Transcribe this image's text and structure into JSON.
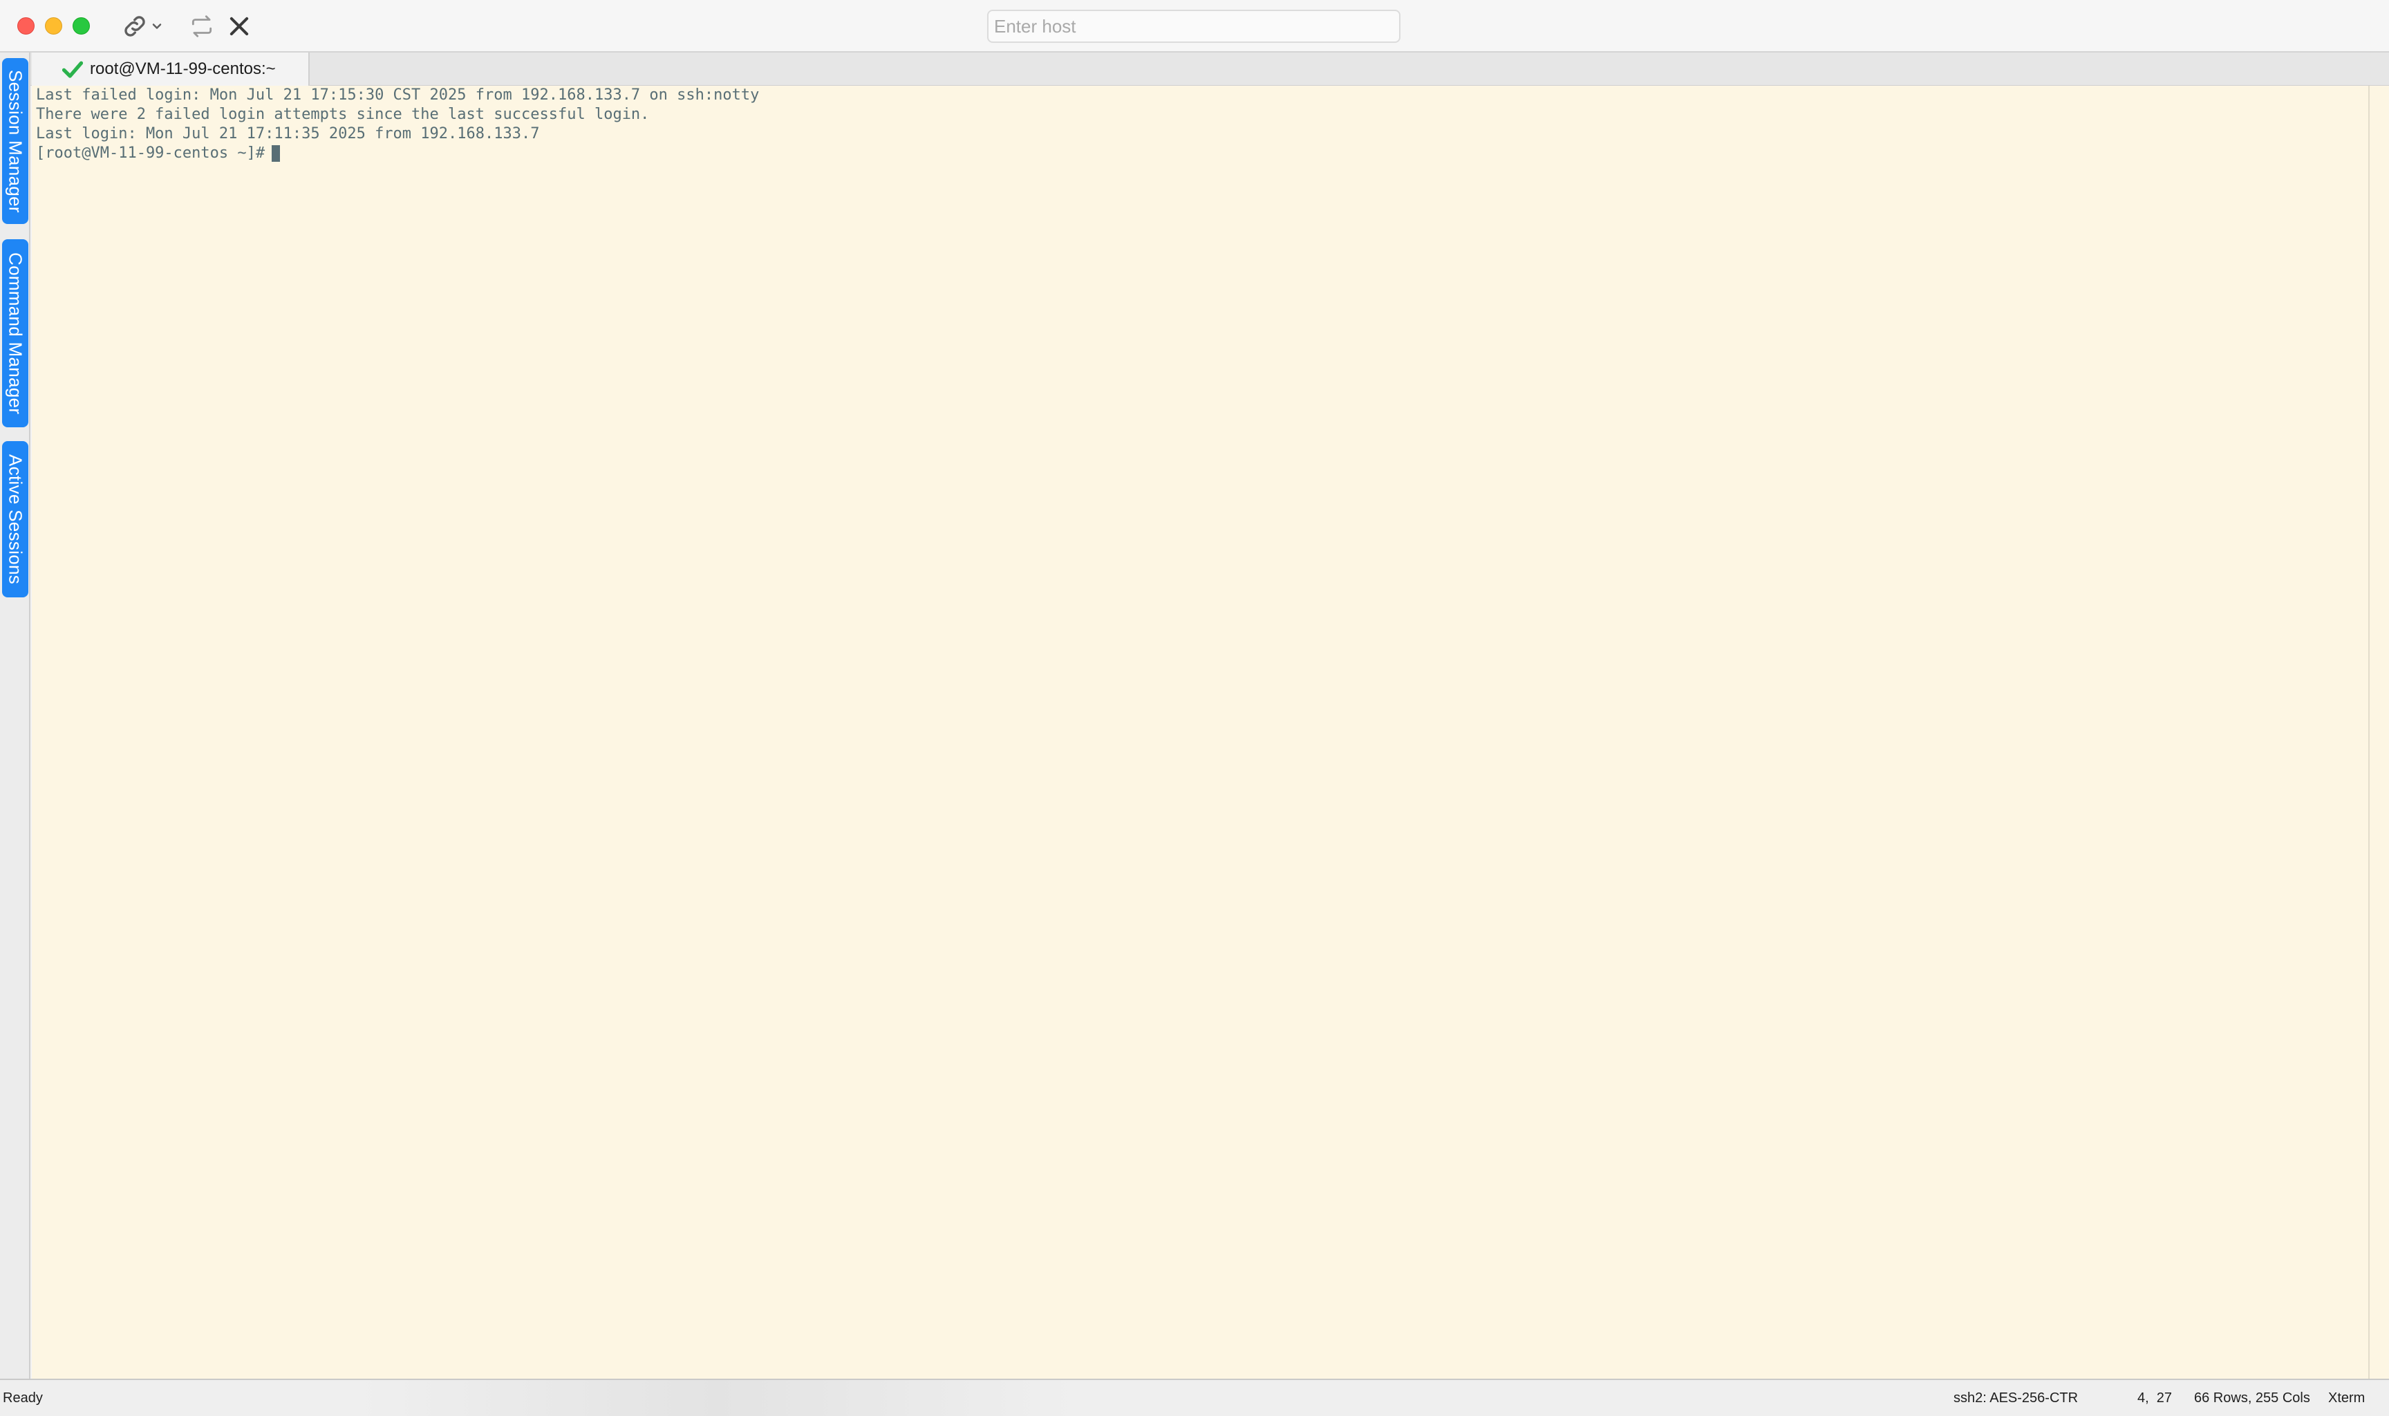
{
  "titlebar": {
    "host_placeholder": "Enter host",
    "host_value": "",
    "icons": {
      "link": "link-icon",
      "dropdown": "chevron-down-icon",
      "reconnect": "reconnect-icon",
      "disconnect": "close-icon"
    }
  },
  "sidebar": {
    "tabs": [
      {
        "label": "Session Manager"
      },
      {
        "label": "Command Manager"
      },
      {
        "label": "Active Sessions"
      }
    ]
  },
  "tabs": [
    {
      "label": "root@VM-11-99-centos:~",
      "status_icon": "check-icon",
      "status_color": "#2bb24c"
    }
  ],
  "terminal": {
    "background": "#fdf6e3",
    "foreground": "#586e75",
    "lines": [
      "Last failed login: Mon Jul 21 17:15:30 CST 2025 from 192.168.133.7 on ssh:notty",
      "There were 2 failed login attempts since the last successful login.",
      "Last login: Mon Jul 21 17:11:35 2025 from 192.168.133.7"
    ],
    "prompt": "[root@VM-11-99-centos ~]#"
  },
  "statusbar": {
    "state": "Ready",
    "cipher": "ssh2: AES-256-CTR",
    "cursor_position": "4,  27",
    "size": "66 Rows, 255 Cols",
    "terminal_type": "Xterm"
  },
  "colors": {
    "accent": "#1f86f5",
    "close": "#fe5f57",
    "minimize": "#febc2e",
    "maximize": "#28c840"
  }
}
